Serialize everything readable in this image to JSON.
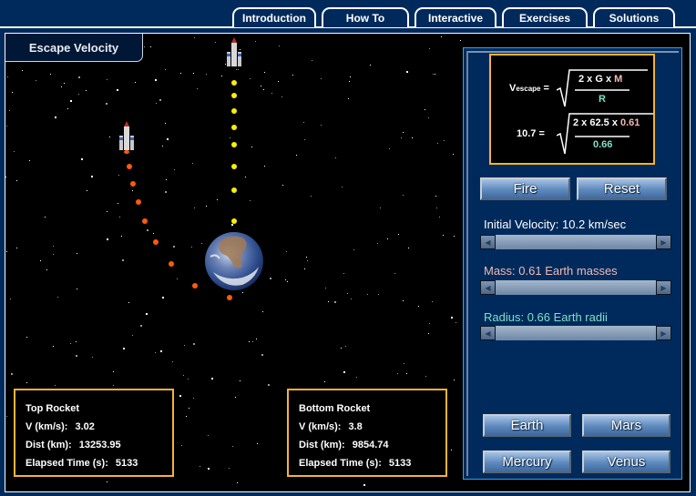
{
  "tabs": [
    {
      "label": "Introduction",
      "active": false
    },
    {
      "label": "How To",
      "active": false
    },
    {
      "label": "Interactive",
      "active": true
    },
    {
      "label": "Exercises",
      "active": false
    },
    {
      "label": "Solutions",
      "active": false
    }
  ],
  "title": "Escape Velocity",
  "formula": {
    "v_symbol": "V",
    "v_subscript": "escape",
    "equals": "=",
    "numerator_general": "2 x G x ",
    "numerator_general_mass": "M",
    "denominator_general": "R",
    "result": "10.7 =",
    "numerator_values": "2 x 62.5 x ",
    "numerator_mass_value": "0.61",
    "denominator_value": "0.66"
  },
  "controls": {
    "fire_label": "Fire",
    "reset_label": "Reset",
    "velocity": {
      "label": "Initial Velocity: 10.2 km/sec",
      "value_km_s": 10.2
    },
    "mass": {
      "label": "Mass: 0.61 Earth masses",
      "value": 0.61
    },
    "radius": {
      "label": "Radius: 0.66 Earth radii",
      "value": 0.66
    },
    "planet_buttons": [
      "Earth",
      "Mars",
      "Mercury",
      "Venus"
    ]
  },
  "top_rocket": {
    "title": "Top Rocket",
    "v_label": "V (km/s):",
    "v_value": "3.02",
    "dist_label": "Dist (km):",
    "dist_value": "13253.95",
    "time_label": "Elapsed Time (s):",
    "time_value": "5133"
  },
  "bottom_rocket": {
    "title": "Bottom Rocket",
    "v_label": "V (km/s):",
    "v_value": "3.8",
    "dist_label": "Dist (km):",
    "dist_value": "9854.74",
    "time_label": "Elapsed Time (s):",
    "time_value": "5133"
  },
  "colors": {
    "background": "#002a5c",
    "accent_border": "#f5b335",
    "yellow_trail": "#f8f000",
    "orange_trail": "#ff5a0a",
    "mass_label": "#f2b8b0",
    "radius_label": "#7fe0c8"
  }
}
